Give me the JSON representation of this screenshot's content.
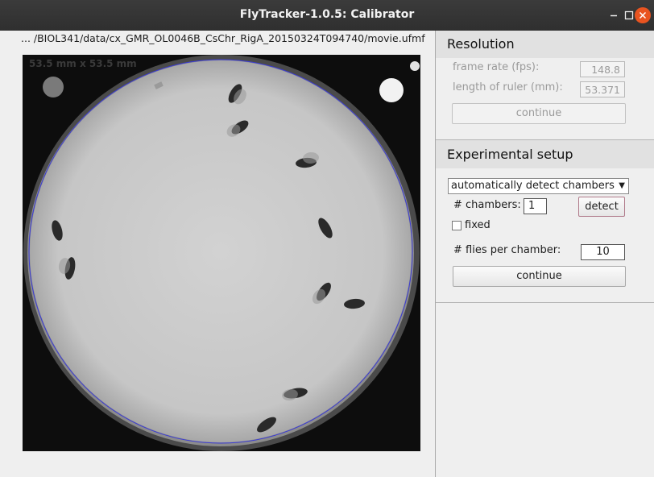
{
  "window": {
    "title": "FlyTracker-1.0.5: Calibrator"
  },
  "file_path": "... /BIOL341/data/cx_GMR_OL0046B_CsChr_RigA_20150324T094740/movie.ufmf",
  "video": {
    "scale_label": "53.5 mm x 53.5 mm"
  },
  "resolution": {
    "heading": "Resolution",
    "frame_rate_label": "frame rate (fps):",
    "frame_rate_value": "148.8",
    "ruler_label": "length of ruler (mm):",
    "ruler_value": "53.371",
    "continue_label": "continue"
  },
  "setup": {
    "heading": "Experimental setup",
    "detect_mode": "automatically detect chambers",
    "chambers_label": "# chambers:",
    "chambers_value": "1",
    "detect_label": "detect",
    "fixed_label": "fixed",
    "fixed_checked": false,
    "flies_label": "# flies per chamber:",
    "flies_value": "10",
    "continue_label": "continue"
  },
  "colors": {
    "titlebar": "#2f2f2f",
    "close_button": "#e95420",
    "chamber_outline": "#3a3ad6"
  }
}
